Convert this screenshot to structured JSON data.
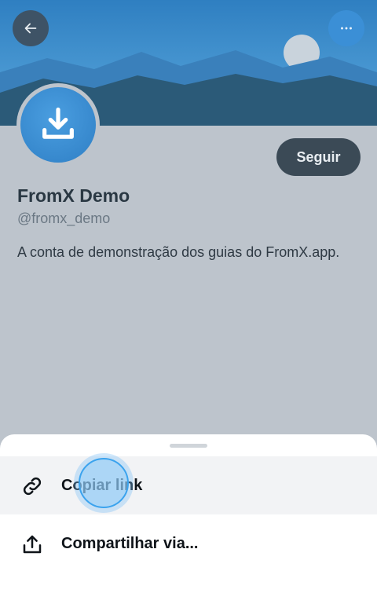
{
  "header": {
    "back_icon": "arrow-left-icon",
    "more_icon": "more-horizontal-icon"
  },
  "profile": {
    "display_name": "FromX Demo",
    "handle": "@fromx_demo",
    "bio": "A conta de demonstração dos guias do FromX.app.",
    "follow_label": "Seguir",
    "avatar_icon": "download-icon"
  },
  "sheet": {
    "items": [
      {
        "label": "Copiar link",
        "icon": "link-icon"
      },
      {
        "label": "Compartilhar via...",
        "icon": "share-icon"
      }
    ]
  },
  "colors": {
    "banner_sky": "#3f90cf",
    "banner_mountain_dark": "#2b5a78",
    "follow_button": "#3b4a56",
    "accent": "#3ba3ee"
  }
}
